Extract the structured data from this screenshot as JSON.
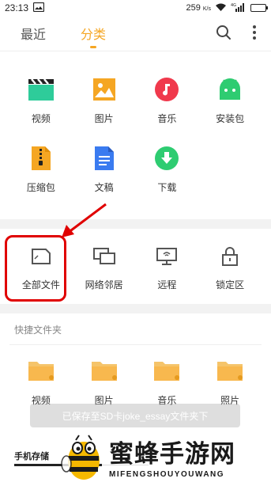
{
  "status_bar": {
    "time": "23:13",
    "speed": "259",
    "speed_unit": "K/s",
    "network": "4G"
  },
  "app_bar": {
    "tabs": [
      {
        "label": "最近",
        "active": false
      },
      {
        "label": "分类",
        "active": true
      }
    ],
    "accent_color": "#f5a623"
  },
  "categories": [
    {
      "label": "视频",
      "icon": "video-clapper-icon",
      "color": "#2ecc9a"
    },
    {
      "label": "图片",
      "icon": "image-icon",
      "color": "#f5a623"
    },
    {
      "label": "音乐",
      "icon": "music-note-icon",
      "color": "#f0394c"
    },
    {
      "label": "安装包",
      "icon": "android-icon",
      "color": "#2ecc71"
    },
    {
      "label": "压缩包",
      "icon": "zip-file-icon",
      "color": "#f5a623"
    },
    {
      "label": "文稿",
      "icon": "document-icon",
      "color": "#3a7bf0"
    },
    {
      "label": "下载",
      "icon": "download-icon",
      "color": "#2ecc71"
    }
  ],
  "tools": [
    {
      "label": "全部文件",
      "icon": "all-files-icon"
    },
    {
      "label": "网络邻居",
      "icon": "network-neighbors-icon"
    },
    {
      "label": "远程",
      "icon": "remote-icon"
    },
    {
      "label": "锁定区",
      "icon": "lock-icon"
    }
  ],
  "quick_folders": {
    "title": "快捷文件夹",
    "items": [
      {
        "label": "视频"
      },
      {
        "label": "图片"
      },
      {
        "label": "音乐"
      },
      {
        "label": "照片"
      }
    ]
  },
  "toast": {
    "text": "已保存至SD卡joke_essay文件夹下"
  },
  "storage": {
    "label": "手机存储",
    "used_fraction": 0.65
  },
  "watermark": {
    "title": "蜜蜂手游网",
    "subtitle": "MIFENGSHOUYOUWANG"
  },
  "highlight_color": "#e00000"
}
